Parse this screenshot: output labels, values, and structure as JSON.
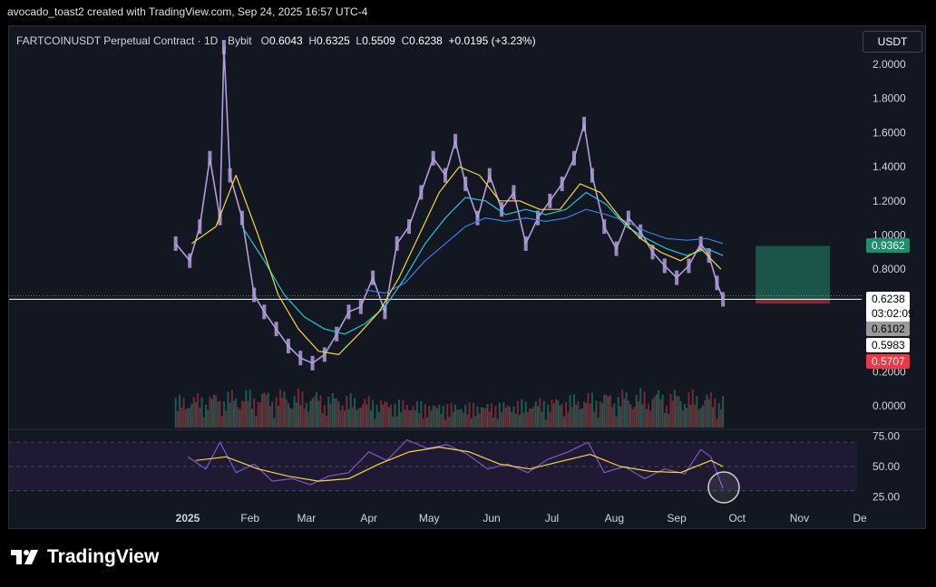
{
  "attribution": "avocado_toast2 created with TradingView.com, Sep 24, 2025 16:57 UTC-4",
  "header": {
    "symbol": "FARTCOINUSDT Perpetual Contract · 1D · Bybit",
    "open_label": "O",
    "open": "0.6043",
    "high_label": "H",
    "high": "0.6325",
    "low_label": "L",
    "low": "0.5509",
    "close_label": "C",
    "close": "0.6238",
    "change": "+0.0195 (+3.23%)"
  },
  "currency_button": "USDT",
  "brand": "TradingView",
  "colors": {
    "background": "#131722",
    "candle": "#b39ddb",
    "ema_fast": "#f5d547",
    "ema_mid": "#26c6da",
    "ema_slow": "#3d7dd8",
    "volume_up": "#1f5a52",
    "volume_down": "#7a2730",
    "rsi_line": "#7e57c2",
    "rsi_ma": "#f5d547",
    "target_zone": "#1d5b4e",
    "stop_zone": "#8e2a33",
    "label_green": "#1b8f6a",
    "label_red": "#f23645",
    "label_gray": "#9a9a9a"
  },
  "chart_data": {
    "type": "line",
    "title": "FARTCOINUSDT Perpetual Contract · 1D · Bybit",
    "price_axis": {
      "ticks": [
        "2.0000",
        "1.8000",
        "1.6000",
        "1.4000",
        "1.2000",
        "1.0000",
        "0.8000",
        "0.2000",
        "0.0000"
      ],
      "tick_values": [
        2.0,
        1.8,
        1.6,
        1.4,
        1.2,
        1.0,
        0.8,
        0.2,
        0.0
      ]
    },
    "time_axis": {
      "ticks": [
        "2025",
        "Feb",
        "Mar",
        "Apr",
        "May",
        "Jun",
        "Jul",
        "Aug",
        "Sep",
        "Oct",
        "Nov",
        "De"
      ]
    },
    "rsi_axis": {
      "ticks": [
        "75.00",
        "50.00",
        "25.00"
      ],
      "tick_values": [
        75,
        50,
        25
      ]
    },
    "price_labels": [
      {
        "text": "0.9362",
        "value": 0.9362,
        "style": "green"
      },
      {
        "text": "0.6238",
        "value": 0.6238,
        "style": "white",
        "countdown": "03:02:09"
      },
      {
        "text": "0.6102",
        "value": 0.6102,
        "style": "gray"
      },
      {
        "text": "0.5983",
        "value": 0.5983,
        "style": "white"
      },
      {
        "text": "0.5707",
        "value": 0.5707,
        "style": "red"
      }
    ],
    "price_series": {
      "name": "",
      "x": [
        "2024-12-26",
        "2025-01-02",
        "2025-01-07",
        "2025-01-12",
        "2025-01-17",
        "2025-01-19",
        "2025-01-22",
        "2025-01-28",
        "2025-02-03",
        "2025-02-08",
        "2025-02-14",
        "2025-02-20",
        "2025-02-26",
        "2025-03-04",
        "2025-03-10",
        "2025-03-16",
        "2025-03-22",
        "2025-03-28",
        "2025-04-03",
        "2025-04-09",
        "2025-04-15",
        "2025-04-21",
        "2025-04-27",
        "2025-05-03",
        "2025-05-09",
        "2025-05-14",
        "2025-05-19",
        "2025-05-25",
        "2025-05-31",
        "2025-06-06",
        "2025-06-12",
        "2025-06-18",
        "2025-06-24",
        "2025-06-30",
        "2025-07-06",
        "2025-07-12",
        "2025-07-17",
        "2025-07-21",
        "2025-07-27",
        "2025-08-02",
        "2025-08-08",
        "2025-08-14",
        "2025-08-20",
        "2025-08-26",
        "2025-09-01",
        "2025-09-07",
        "2025-09-13",
        "2025-09-17",
        "2025-09-21",
        "2025-09-24"
      ],
      "y": [
        0.95,
        0.85,
        1.05,
        1.45,
        1.1,
        2.1,
        1.35,
        1.1,
        0.65,
        0.55,
        0.45,
        0.35,
        0.28,
        0.25,
        0.3,
        0.42,
        0.55,
        0.58,
        0.75,
        0.55,
        0.95,
        1.05,
        1.25,
        1.45,
        1.35,
        1.55,
        1.3,
        1.1,
        1.35,
        1.15,
        1.25,
        0.95,
        1.1,
        1.2,
        1.3,
        1.45,
        1.65,
        1.35,
        1.05,
        0.92,
        1.1,
        1.02,
        0.9,
        0.82,
        0.75,
        0.82,
        0.95,
        0.88,
        0.72,
        0.6238
      ]
    },
    "ema_fast": {
      "x": [
        "2025-01-03",
        "2025-01-15",
        "2025-01-25",
        "2025-02-05",
        "2025-02-15",
        "2025-02-25",
        "2025-03-07",
        "2025-03-17",
        "2025-03-27",
        "2025-04-06",
        "2025-04-16",
        "2025-04-26",
        "2025-05-06",
        "2025-05-16",
        "2025-05-26",
        "2025-06-05",
        "2025-06-15",
        "2025-06-25",
        "2025-07-05",
        "2025-07-15",
        "2025-07-25",
        "2025-08-04",
        "2025-08-14",
        "2025-08-24",
        "2025-09-03",
        "2025-09-13",
        "2025-09-23"
      ],
      "y": [
        0.95,
        1.05,
        1.35,
        1.0,
        0.65,
        0.45,
        0.32,
        0.3,
        0.42,
        0.55,
        0.75,
        1.0,
        1.25,
        1.4,
        1.35,
        1.2,
        1.2,
        1.15,
        1.15,
        1.3,
        1.25,
        1.1,
        0.98,
        0.9,
        0.85,
        0.92,
        0.8
      ]
    },
    "ema_mid": {
      "x": [
        "2025-01-28",
        "2025-02-08",
        "2025-02-18",
        "2025-02-28",
        "2025-03-10",
        "2025-03-20",
        "2025-03-30",
        "2025-04-09",
        "2025-04-19",
        "2025-04-29",
        "2025-05-09",
        "2025-05-19",
        "2025-05-29",
        "2025-06-08",
        "2025-06-18",
        "2025-06-28",
        "2025-07-08",
        "2025-07-18",
        "2025-07-28",
        "2025-08-07",
        "2025-08-17",
        "2025-08-27",
        "2025-09-06",
        "2025-09-16",
        "2025-09-24"
      ],
      "y": [
        1.05,
        0.85,
        0.65,
        0.52,
        0.45,
        0.42,
        0.48,
        0.58,
        0.75,
        0.95,
        1.1,
        1.22,
        1.2,
        1.12,
        1.15,
        1.12,
        1.15,
        1.25,
        1.18,
        1.05,
        0.98,
        0.92,
        0.88,
        0.92,
        0.88
      ]
    },
    "ema_slow": {
      "x": [
        "2025-03-30",
        "2025-04-09",
        "2025-04-19",
        "2025-04-29",
        "2025-05-09",
        "2025-05-19",
        "2025-05-29",
        "2025-06-08",
        "2025-06-18",
        "2025-06-28",
        "2025-07-08",
        "2025-07-18",
        "2025-07-28",
        "2025-08-07",
        "2025-08-17",
        "2025-08-27",
        "2025-09-06",
        "2025-09-16",
        "2025-09-24"
      ],
      "y": [
        0.68,
        0.66,
        0.72,
        0.85,
        0.95,
        1.05,
        1.1,
        1.08,
        1.1,
        1.08,
        1.1,
        1.15,
        1.12,
        1.08,
        1.02,
        0.98,
        0.97,
        0.98,
        0.95
      ]
    },
    "rsi": {
      "x": [
        "2025-01-01",
        "2025-01-10",
        "2025-01-17",
        "2025-01-25",
        "2025-02-03",
        "2025-02-12",
        "2025-02-22",
        "2025-03-03",
        "2025-03-12",
        "2025-03-22",
        "2025-04-01",
        "2025-04-10",
        "2025-04-20",
        "2025-04-30",
        "2025-05-10",
        "2025-05-20",
        "2025-05-30",
        "2025-06-09",
        "2025-06-19",
        "2025-06-29",
        "2025-07-09",
        "2025-07-19",
        "2025-07-27",
        "2025-08-06",
        "2025-08-16",
        "2025-08-26",
        "2025-09-05",
        "2025-09-13",
        "2025-09-18",
        "2025-09-24"
      ],
      "y": [
        58,
        48,
        70,
        45,
        52,
        38,
        40,
        35,
        42,
        45,
        62,
        55,
        72,
        65,
        68,
        60,
        48,
        52,
        45,
        56,
        62,
        70,
        45,
        50,
        40,
        48,
        44,
        64,
        58,
        32
      ]
    },
    "rsi_ma": {
      "x": [
        "2025-01-05",
        "2025-01-20",
        "2025-02-05",
        "2025-02-20",
        "2025-03-07",
        "2025-03-22",
        "2025-04-06",
        "2025-04-21",
        "2025-05-06",
        "2025-05-21",
        "2025-06-05",
        "2025-06-20",
        "2025-07-05",
        "2025-07-20",
        "2025-08-04",
        "2025-08-19",
        "2025-09-03",
        "2025-09-18",
        "2025-09-24"
      ],
      "y": [
        55,
        58,
        48,
        42,
        38,
        40,
        52,
        62,
        66,
        62,
        52,
        48,
        54,
        60,
        50,
        46,
        45,
        55,
        50
      ]
    },
    "trade_box": {
      "start": "2025-09-24",
      "end": "2025-10-24",
      "target": 0.9362,
      "entry": 0.6238,
      "stop": 0.5983
    }
  }
}
